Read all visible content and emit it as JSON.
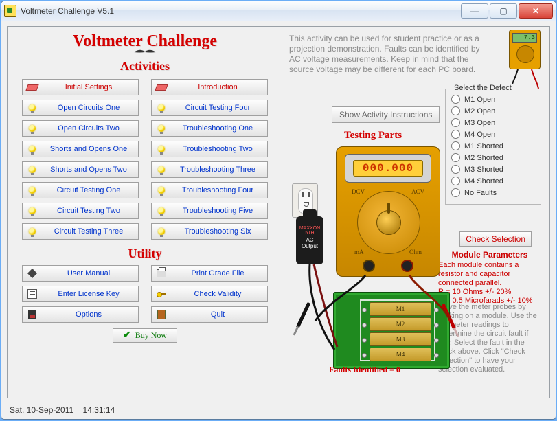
{
  "window": {
    "title": "Voltmeter Challenge V5.1"
  },
  "headings": {
    "app": "Voltmeter Challenge",
    "activities": "Activities",
    "utility": "Utility"
  },
  "activities_left": [
    "Initial Settings",
    "Open Circuits One",
    "Open Circuits Two",
    "Shorts and Opens One",
    "Shorts and Opens Two",
    "Circuit Testing One",
    "Circuit Testing Two",
    "Circuit Testing Three"
  ],
  "activities_right": [
    "Introduction",
    "Circuit Testing Four",
    "Troubleshooting One",
    "Troubleshooting Two",
    "Troubleshooting Three",
    "Troubleshooting Four",
    "Troubleshooting Five",
    "Troubleshooting Six"
  ],
  "utility": {
    "user_manual": "User Manual",
    "print_grade": "Print Grade File",
    "enter_license": "Enter License Key",
    "check_validity": "Check Validity",
    "options": "Options",
    "quit": "Quit",
    "buy_now": "Buy Now"
  },
  "intro_text": "This activity can be used for student practice or as a projection demonstration. Faults can be identified by AC voltage measurements. Keep in mind that the source voltage may be different for each PC board.",
  "show_instructions": "Show Activity Instructions",
  "testing_title": "Testing Parts",
  "mini_meter_value": "7.3",
  "meter": {
    "readout": "000.000",
    "dcv": "DCV",
    "acv": "ACV",
    "ma": "mA",
    "ohm": "Ohm"
  },
  "plug": {
    "brand": "MAXXON 5TH",
    "label": "AC\nOutput"
  },
  "defect_group": {
    "legend": "Select the Defect",
    "options": [
      "M1 Open",
      "M2 Open",
      "M3 Open",
      "M4 Open",
      "M1 Shorted",
      "M2 Shorted",
      "M3 Shorted",
      "M4 Shorted",
      "No Faults"
    ]
  },
  "check_selection": "Check Selection",
  "module_params": {
    "title": "Module Parameters",
    "line1": "Each module contains a resistor and capacitor connected parallel.",
    "line2": "R = 10 Ohms +/- 20%",
    "line3": "C = 0.5 Microfarads +/- 10%"
  },
  "help_text": "Move the meter probes by clicking on a module. Use the voltmeter readings to determine the circuit fault if any. Select the fault in the block above. Click \"Check Selection\" to have your selection evaluated.",
  "modules": [
    "M1",
    "M2",
    "M3",
    "M4"
  ],
  "faults_line": "Faults Identified = 0",
  "status": {
    "date": "Sat.  10-Sep-2011",
    "time": "14:31:14"
  }
}
